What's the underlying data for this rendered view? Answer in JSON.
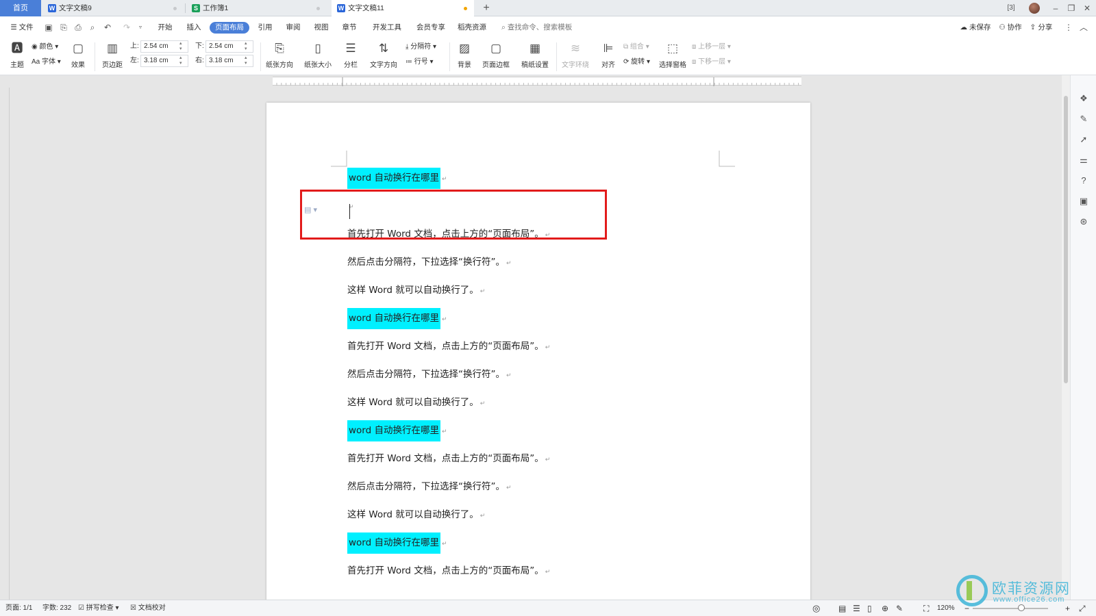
{
  "tabs": {
    "home": "首页",
    "items": [
      {
        "label": "文字文稿9",
        "icon": "W",
        "color": "#2b66d9"
      },
      {
        "label": "工作簿1",
        "icon": "S",
        "color": "#1ba05a"
      },
      {
        "label": "文字文稿11",
        "icon": "W",
        "color": "#2b66d9",
        "active": true
      }
    ],
    "add": "+",
    "badge": "3"
  },
  "menu": {
    "file": "文件",
    "items": [
      "开始",
      "插入",
      "页面布局",
      "引用",
      "审阅",
      "视图",
      "章节",
      "开发工具",
      "会员专享",
      "稻壳资源"
    ],
    "active": "页面布局",
    "search_placeholder": "查找命令、搜索模板",
    "unsaved": "未保存",
    "collaborate": "协作",
    "share": "分享"
  },
  "ribbon": {
    "theme": "主题",
    "color": "颜色",
    "font": "字体",
    "effect": "效果",
    "margins": "页边距",
    "top_label": "上:",
    "top_value": "2.54 cm",
    "bottom_label": "下:",
    "bottom_value": "2.54 cm",
    "left_label": "左:",
    "left_value": "3.18 cm",
    "right_label": "右:",
    "right_value": "3.18 cm",
    "orientation": "纸张方向",
    "size": "纸张大小",
    "columns": "分栏",
    "text_direction": "文字方向",
    "breaks": "分隔符",
    "line_numbers": "行号",
    "background": "背景",
    "page_border": "页面边框",
    "manuscript": "稿纸设置",
    "wrap_text": "文字环绕",
    "align": "对齐",
    "group": "组合",
    "rotate": "旋转",
    "selection_pane": "选择窗格",
    "bring_forward": "上移一层",
    "send_backward": "下移一层"
  },
  "document": {
    "paragraphs": [
      {
        "text": "word 自动换行在哪里",
        "highlight": true
      },
      {
        "text": "",
        "highlight": false,
        "cursor": true
      },
      {
        "text": "首先打开 Word 文档，点击上方的“页面布局”。",
        "highlight": false
      },
      {
        "text": "然后点击分隔符，下拉选择“换行符”。",
        "highlight": false
      },
      {
        "text": "这样 Word 就可以自动换行了。",
        "highlight": false
      },
      {
        "text": "word 自动换行在哪里",
        "highlight": true
      },
      {
        "text": "首先打开 Word 文档，点击上方的“页面布局”。",
        "highlight": false
      },
      {
        "text": "然后点击分隔符，下拉选择“换行符”。",
        "highlight": false
      },
      {
        "text": "这样 Word 就可以自动换行了。",
        "highlight": false
      },
      {
        "text": "word 自动换行在哪里",
        "highlight": true
      },
      {
        "text": "首先打开 Word 文档，点击上方的“页面布局”。",
        "highlight": false
      },
      {
        "text": "然后点击分隔符，下拉选择“换行符”。",
        "highlight": false
      },
      {
        "text": "这样 Word 就可以自动换行了。",
        "highlight": false
      },
      {
        "text": "word 自动换行在哪里",
        "highlight": true
      },
      {
        "text": "首先打开 Word 文档，点击上方的“页面布局”。",
        "highlight": false
      }
    ],
    "paragraph_mark": "↵",
    "highlight_color": "#00f0ff"
  },
  "status": {
    "page": "页面: 1/1",
    "words": "字数: 232",
    "spell_check": "拼写检查",
    "doc_check": "文档校对",
    "zoom": "120%"
  },
  "watermark": {
    "title": "欧菲资源网",
    "url": "www.office26.com"
  }
}
